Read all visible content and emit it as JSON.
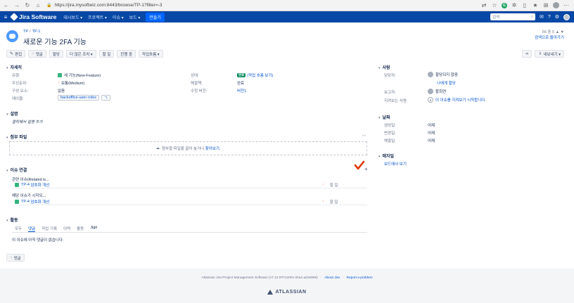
{
  "browser": {
    "url": "https://jira.mysoftwiz.com:8443/browse/TP-1?filter=-3"
  },
  "nav": {
    "product": "Jira Software",
    "items": [
      "대시보드 ▾",
      "프로젝트 ▾",
      "이슈 ▾",
      "보드 ▾"
    ],
    "create": "만들기",
    "search_placeholder": "검색"
  },
  "issue": {
    "crumb_project": "TP",
    "crumb_key": "TP-1",
    "summary": "새로운 기능 2FA 기능",
    "pager": "56 중 5",
    "back_to_search": "검색으로 돌아가기"
  },
  "toolbar": {
    "edit": "편집",
    "comment": "댓글",
    "assign": "할당",
    "more": "더 많은 조치 ▾",
    "todo": "할 일",
    "inprogress": "진행 중",
    "workflow": "작업흐름 ▾",
    "share": "",
    "export": "내보내기 ▾"
  },
  "details": {
    "title": "자세히",
    "type_label": "유형:",
    "type_value": "새 기능(New-Feature)",
    "priority_label": "우선순위:",
    "priority_value": "보통(Medium)",
    "component_label": "구성 요소:",
    "component_value": "없음",
    "labels_label": "레이블:",
    "labels": [
      "backoffice-user-roles",
      "ㄱ"
    ],
    "status_label": "상태:",
    "status_lozenge": "완료",
    "status_link": "(작업 흐름 보기)",
    "resolution_label": "해결책:",
    "resolution_value": "완료",
    "fixversion_label": "수정 버전:",
    "fixversion_value": "버전1"
  },
  "description": {
    "title": "설명",
    "placeholder": "클릭해서 설명 추가"
  },
  "attachments": {
    "title": "첨부 파일",
    "drop_text": "첨부할 파일을 끌어 놓거나, ",
    "browse": "찾아보기."
  },
  "issue_links": {
    "title": "이슈 연결",
    "groups": [
      {
        "label": "관련 이슈(Related is...",
        "items": [
          {
            "key": "TP-4",
            "summary": "암호화 개선",
            "status": "할 일"
          }
        ]
      },
      {
        "label": "해당 이슈가 시작되...",
        "items": [
          {
            "key": "TP-4",
            "summary": "암호화 개선",
            "status": "할 일"
          }
        ]
      }
    ]
  },
  "activity": {
    "title": "활동",
    "tabs": [
      "모두",
      "댓글",
      "작업 기록",
      "이력",
      "활동",
      "Jigit"
    ],
    "active_tab": "댓글",
    "empty": "이 이슈에 아직 댓글이 없습니다.",
    "comment_button": "댓글"
  },
  "people": {
    "title": "사람",
    "assignee_label": "담당자:",
    "assignee_value": "할당되지 않음",
    "assign_to_me": "나에게 할당",
    "reporter_label": "보고자:",
    "reporter_value": "황희연",
    "watchers_label": "지켜보는 사람:",
    "watchers_count": "2",
    "watch_text": "이 이슈를 지켜보기 시작합니다."
  },
  "dates": {
    "title": "날짜",
    "created_label": "생성일:",
    "created_value": "어제",
    "updated_label": "변경일:",
    "updated_value": "어제",
    "resolved_label": "해결일:",
    "resolved_value": "어제"
  },
  "agile": {
    "title": "애자일",
    "board_link": "보드에서 보기"
  },
  "footer": {
    "version": "Atlassian Jira Project Management Software (v7.12.0#712001-sha1:ad16905)",
    "about": "About Jira",
    "report": "Report a problem",
    "brand": "ATLASSIAN"
  },
  "colors": {
    "nav": "#0747a6",
    "link": "#0052cc",
    "done": "#00875a",
    "check": "#de350b"
  }
}
